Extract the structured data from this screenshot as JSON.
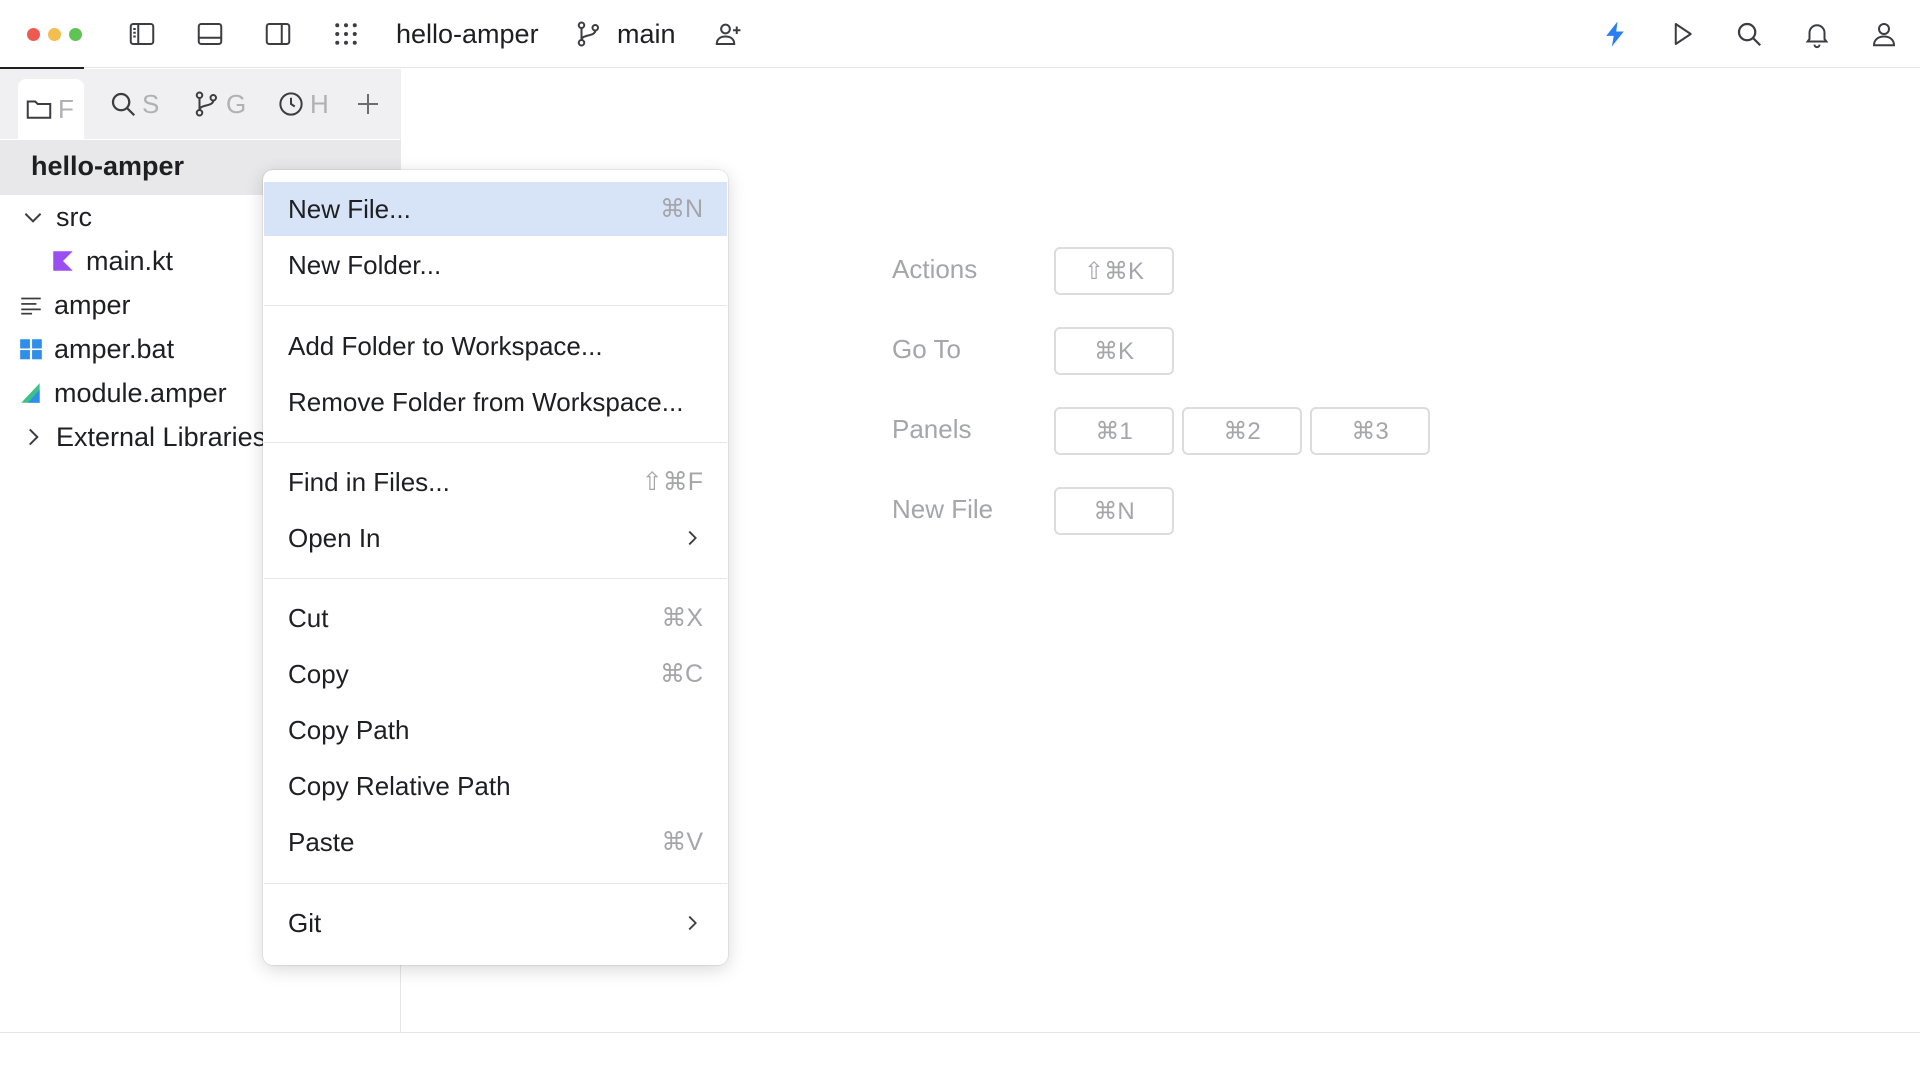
{
  "titlebar": {
    "project_name": "hello-amper",
    "branch": "main",
    "traffic_colors": [
      "#ee5a52",
      "#f3bd4f",
      "#5fc454"
    ],
    "accent_color": "#2a7ff0"
  },
  "sidebar": {
    "tabs": [
      {
        "icon": "folder-icon",
        "label": "F"
      },
      {
        "icon": "search-icon",
        "label": "S"
      },
      {
        "icon": "branch-icon",
        "label": "G"
      },
      {
        "icon": "clock-icon",
        "label": "H"
      }
    ],
    "project": "hello-amper",
    "tree": [
      {
        "label": "src",
        "icon": "chevron-down-icon"
      },
      {
        "label": "main.kt",
        "icon": "kotlin-icon"
      },
      {
        "label": "amper",
        "icon": "text-file-icon"
      },
      {
        "label": "amper.bat",
        "icon": "windows-icon"
      },
      {
        "label": "module.amper",
        "icon": "amper-icon"
      },
      {
        "label": "External Libraries",
        "icon": "chevron-right-icon"
      }
    ]
  },
  "menu": {
    "items": [
      {
        "label": "New File...",
        "shortcut": "⌘N"
      },
      {
        "label": "New Folder...",
        "shortcut": ""
      },
      {
        "label": "Add Folder to Workspace...",
        "shortcut": ""
      },
      {
        "label": "Remove Folder from Workspace...",
        "shortcut": ""
      },
      {
        "label": "Find in Files...",
        "shortcut": "⇧⌘F"
      },
      {
        "label": "Open In",
        "shortcut": ""
      },
      {
        "label": "Cut",
        "shortcut": "⌘X"
      },
      {
        "label": "Copy",
        "shortcut": "⌘C"
      },
      {
        "label": "Copy Path",
        "shortcut": ""
      },
      {
        "label": "Copy Relative Path",
        "shortcut": ""
      },
      {
        "label": "Paste",
        "shortcut": "⌘V"
      },
      {
        "label": "Git",
        "shortcut": ""
      }
    ]
  },
  "hints": [
    {
      "label": "Actions",
      "keys": [
        "⇧⌘K"
      ]
    },
    {
      "label": "Go To",
      "keys": [
        "⌘K"
      ]
    },
    {
      "label": "Panels",
      "keys": [
        "⌘1",
        "⌘2",
        "⌘3"
      ]
    },
    {
      "label": "New File",
      "keys": [
        "⌘N"
      ]
    }
  ]
}
